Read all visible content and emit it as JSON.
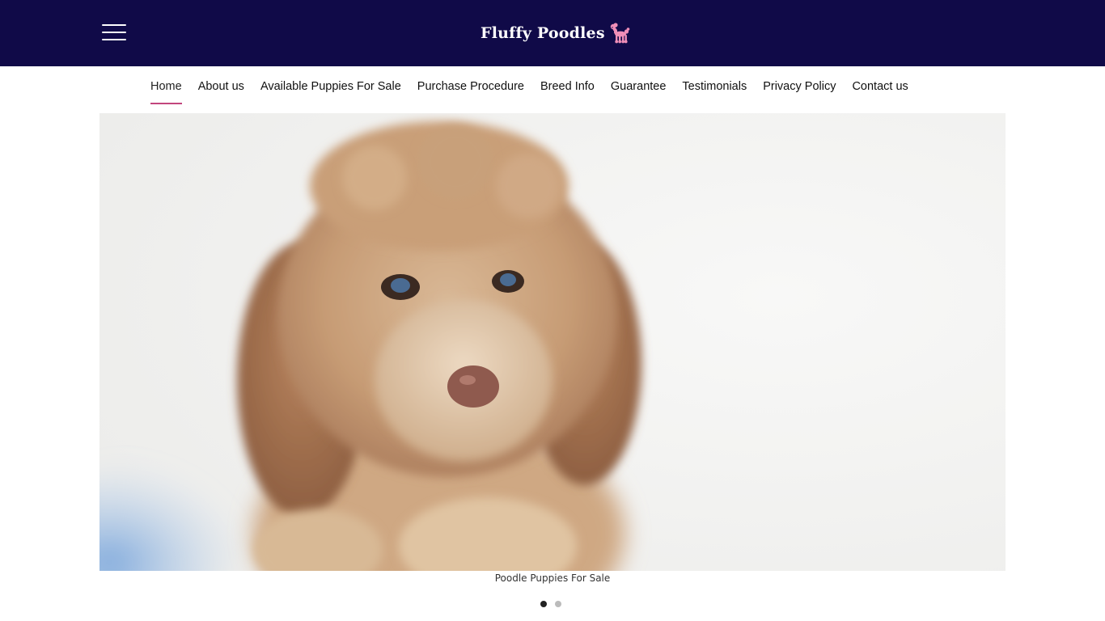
{
  "header": {
    "logo_text": "Fluffy Poodles",
    "logo_icon": "poodle-icon",
    "menu_icon": "hamburger-menu-icon",
    "background_color": "#100a48",
    "logo_icon_color": "#f08fb8"
  },
  "nav": {
    "items": [
      {
        "label": "Home",
        "active": true
      },
      {
        "label": "About us"
      },
      {
        "label": "Available Puppies For Sale"
      },
      {
        "label": "Purchase Procedure"
      },
      {
        "label": "Breed Info"
      },
      {
        "label": "Guarantee"
      },
      {
        "label": "Testimonials"
      },
      {
        "label": "Privacy Policy"
      },
      {
        "label": "Contact us"
      }
    ],
    "active_underline_color": "#c2467d"
  },
  "slider": {
    "caption": "Poodle Puppies For Sale",
    "slide_count": 2,
    "current_slide": 1
  }
}
